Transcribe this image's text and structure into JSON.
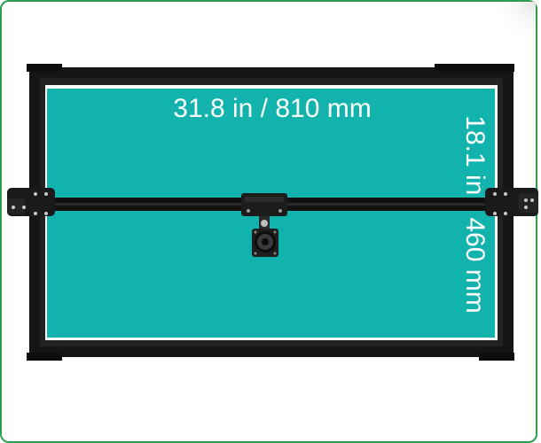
{
  "image": {
    "subject": "laser engraver frame top view",
    "colors": {
      "work_area": "#12b3ad",
      "frame": "#1a1a1a",
      "border": "#2e9e4c",
      "label": "#ffffff"
    }
  },
  "dimensions": {
    "width_label": "31.8 in / 810 mm",
    "height_label": "18.1 in / 460 mm"
  }
}
